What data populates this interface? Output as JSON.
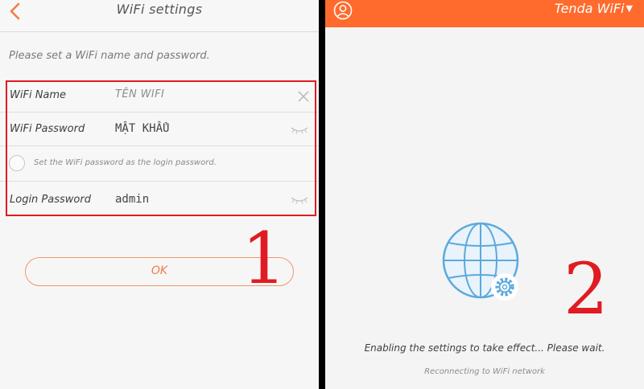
{
  "left_screen": {
    "title": "WiFi settings",
    "instruction": "Please set a WiFi name and password.",
    "wifi_name": {
      "label": "WiFi Name",
      "value": "TÊN WIFI"
    },
    "wifi_password": {
      "label": "WiFi Password",
      "value": "MẬT KHẨU"
    },
    "same_password_option": {
      "label": "Set the WiFi password as the login password.",
      "checked": false
    },
    "login_password": {
      "label": "Login Password",
      "value": "admin"
    },
    "ok_label": "OK",
    "step_number": "1"
  },
  "right_screen": {
    "network_name": "Tenda WiFi",
    "status_message": "Enabling the settings to take effect... Please wait.",
    "sub_status": "Reconnecting to WiFi network",
    "step_number": "2"
  },
  "colors": {
    "accent_orange": "#ff6b2c",
    "annotation_red": "#e01b22",
    "globe_blue": "#5ca9dd"
  },
  "icons": [
    "back-arrow-icon",
    "clear-icon",
    "eye-icon",
    "user-icon",
    "dropdown-caret-icon",
    "globe-icon",
    "gear-icon"
  ]
}
